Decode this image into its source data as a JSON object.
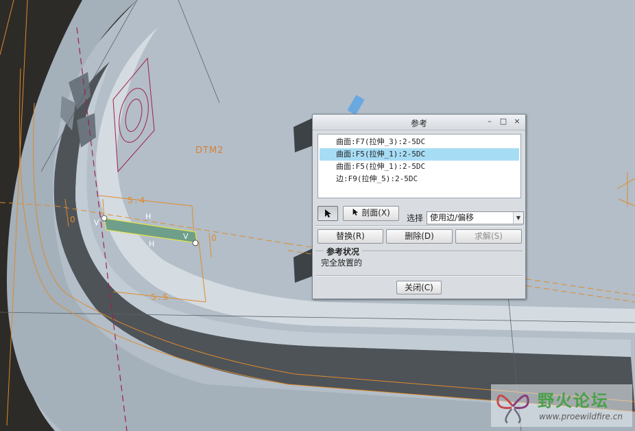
{
  "viewport": {
    "datum_label": "DTM2",
    "dimensions": [
      "5.4",
      "5.5",
      "0",
      "0"
    ],
    "constraint_marks": [
      "V",
      "H",
      "H",
      "V"
    ]
  },
  "dialog": {
    "title": "参考",
    "title_buttons": [
      "–",
      "□",
      "×"
    ],
    "references": [
      {
        "text": "曲面:F7(拉伸_3):2-5DC",
        "selected": false
      },
      {
        "text": "曲面:F5(拉伸_1):2-5DC",
        "selected": true
      },
      {
        "text": "曲面:F5(拉伸_1):2-5DC",
        "selected": false
      },
      {
        "text": "边:F9(拉伸_5):2-5DC",
        "selected": false
      }
    ],
    "xsec_button": "剖面(X)",
    "select_label": "选择",
    "select_value": "使用边/偏移",
    "replace_button": "替换(R)",
    "delete_button": "删除(D)",
    "solve_button": "求解(S)",
    "status_group_title": "参考状况",
    "status_text": "完全放置的",
    "close_button": "关闭(C)"
  },
  "watermark": {
    "title": "野火论坛",
    "url": "www.proewildfire.cn"
  },
  "colors": {
    "background": "#2d2b28",
    "model_surface": "#b6c1ca",
    "selection_highlight": "#a7dcf5",
    "dimension_orange": "#e08a2a"
  }
}
